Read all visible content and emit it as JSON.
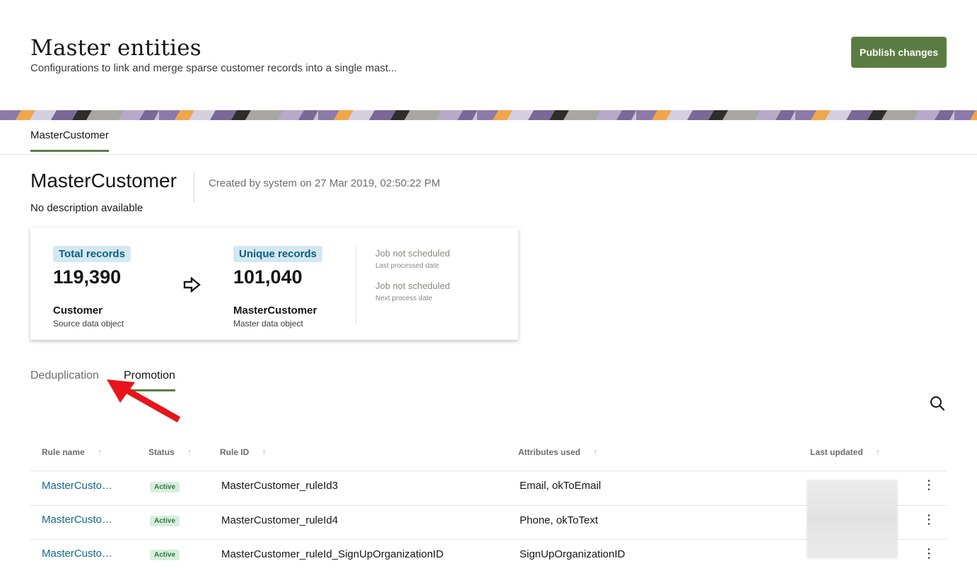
{
  "header": {
    "title": "Master entities",
    "subtitle": "Configurations to link and merge sparse customer records into a single mast...",
    "publish_label": "Publish changes"
  },
  "colors": {
    "accent": "#5a7c42",
    "link": "#0e6a8f",
    "pill_bg": "#d4e8f1",
    "badge_bg": "#d8eedc",
    "annotation_arrow": "#e8141b"
  },
  "entity_tab": "MasterCustomer",
  "entity": {
    "name": "MasterCustomer",
    "created_by": "Created by system on 27 Mar 2019, 02:50:22 PM",
    "description": "No description available"
  },
  "summary": {
    "total_label": "Total records",
    "total_value": "119,390",
    "source_name": "Customer",
    "source_sub": "Source data object",
    "unique_label": "Unique records",
    "unique_value": "101,040",
    "master_name": "MasterCustomer",
    "master_sub": "Master data object",
    "arrow_icon": "arrow-right-outline-icon",
    "job1_main": "Job not scheduled",
    "job1_sub": "Last processed date",
    "job2_main": "Job not scheduled",
    "job2_sub": "Next process date"
  },
  "sub_tabs": [
    "Deduplication",
    "Promotion"
  ],
  "table": {
    "headers": [
      "Rule name",
      "Status",
      "Rule ID",
      "Attributes used",
      "Last updated"
    ],
    "rows": [
      {
        "name": "MasterCusto…",
        "status": "Active",
        "rule_id": "MasterCustomer_ruleId3",
        "attributes": "Email, okToEmail"
      },
      {
        "name": "MasterCusto…",
        "status": "Active",
        "rule_id": "MasterCustomer_ruleId4",
        "attributes": "Phone, okToText"
      },
      {
        "name": "MasterCusto…",
        "status": "Active",
        "rule_id": "MasterCustomer_ruleId_SignUpOrganizationID",
        "attributes": "SignUpOrganizationID"
      }
    ]
  }
}
